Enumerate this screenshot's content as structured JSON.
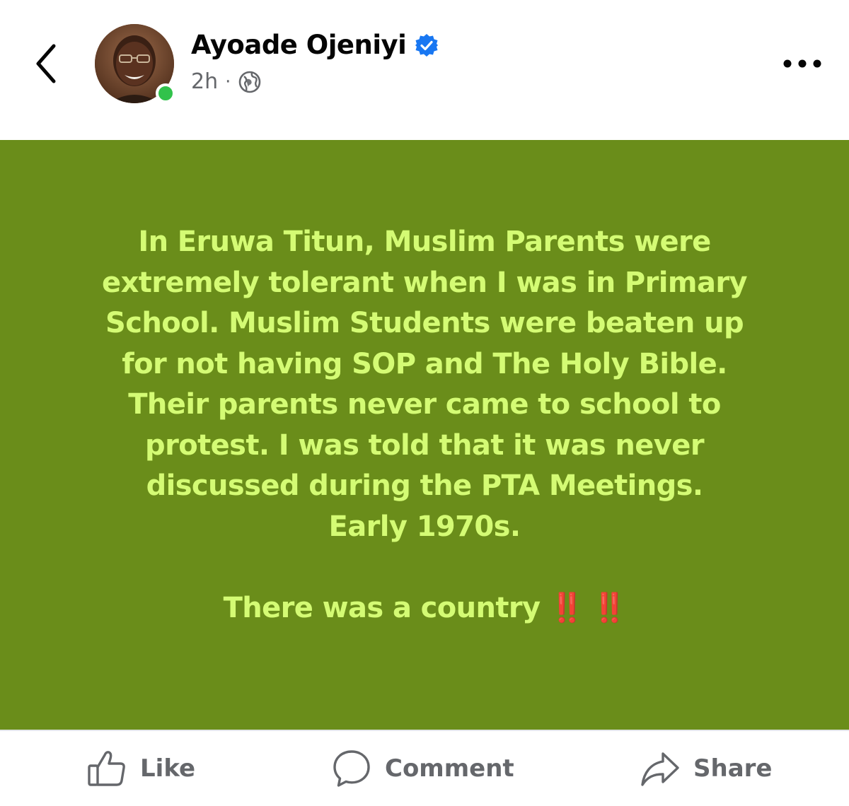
{
  "post": {
    "author_name": "Ayoade Ojeniyi",
    "time": "2h",
    "separator": "·",
    "audience_icon": "globe-icon",
    "verified_icon": "verified-badge-icon",
    "background_color": "#6a8d1a",
    "text_color": "#d4fb74",
    "text_lines": [
      "In Eruwa Titun, Muslim Parents were",
      "extremely tolerant when I was in Primary",
      "School. Muslim Students were beaten up",
      "for not having SOP and The Holy Bible.",
      "Their parents never came to school to",
      "protest. I was told that it was never",
      "discussed during the PTA Meetings.",
      "Early 1970s."
    ],
    "closing_text": "There was a country",
    "closing_emoji": "‼️ ‼️"
  },
  "actions": {
    "like_label": "Like",
    "comment_label": "Comment",
    "share_label": "Share"
  },
  "colors": {
    "accent_blue": "#1877f2",
    "online_green": "#31c24b",
    "secondary_text": "#65676b"
  }
}
